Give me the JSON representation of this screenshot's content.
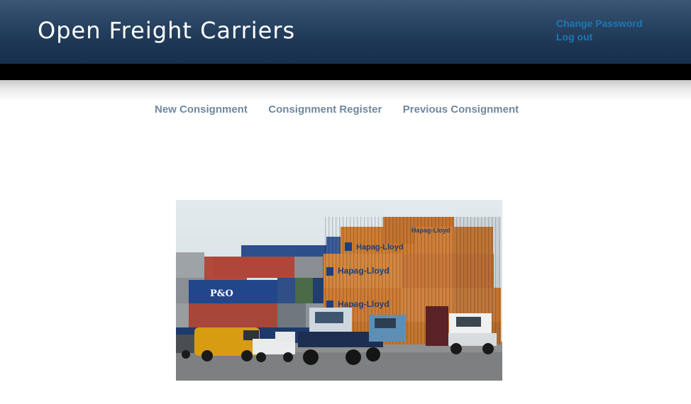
{
  "header": {
    "title": "Open Freight Carriers",
    "user_links": [
      "Change Password",
      "Log out"
    ]
  },
  "nav": {
    "items": [
      "New Consignment",
      "Consignment Register",
      "Previous Consignment"
    ]
  },
  "photo": {
    "container_labels": [
      "Hapag-Lloyd",
      "Hapag-Lloyd",
      "Hapag-Lloyd",
      "Hapag-Lloyd",
      "P&O"
    ]
  },
  "colors": {
    "header_dark": "#16304e",
    "header_light": "#3b5676",
    "link": "#1b79b3",
    "nav_text": "#70889e"
  }
}
